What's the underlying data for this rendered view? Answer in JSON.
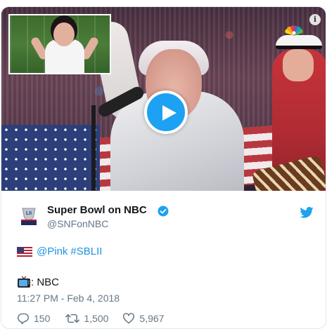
{
  "video": {
    "inset_alt": "Inset video of person performing sign language",
    "overlay_logo": "nbc-peacock-icon",
    "info_icon": "i",
    "play_icon": "play-icon"
  },
  "author": {
    "name": "Super Bowl on NBC",
    "handle": "@SNFonNBC",
    "avatar_icon": "super-bowl-lii-logo",
    "verified_icon": "verified-badge-icon"
  },
  "tweet": {
    "mention": "@Pink",
    "hashtag": "#SBLII",
    "line2_text": ": NBC",
    "timestamp": "11:27 PM - Feb 4, 2018"
  },
  "actions": {
    "replies": "150",
    "retweets": "1,500",
    "likes": "5,967"
  },
  "colors": {
    "brand_blue": "#1da1f2",
    "link_blue": "#1b95e0",
    "muted": "#657786"
  }
}
